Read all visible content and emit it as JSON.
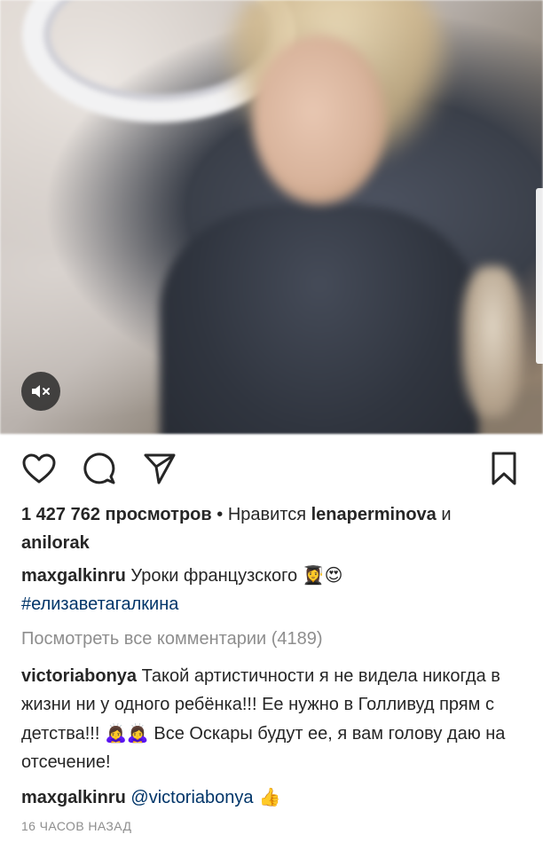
{
  "video": {
    "mute_icon": "speaker-muted-icon"
  },
  "actions": {
    "like_icon": "heart-icon",
    "comment_icon": "comment-bubble-icon",
    "share_icon": "paper-plane-icon",
    "save_icon": "bookmark-icon"
  },
  "stats": {
    "views": "1 427 762 просмотров",
    "separator": " • ",
    "liked_by_prefix": "Нравится ",
    "liked_user_1": "lenaperminova",
    "and": " и",
    "liked_user_2": "anilorak"
  },
  "caption": {
    "username": "maxgalkinru",
    "text": " Уроки французского ",
    "emoji_1": "👩‍🎓",
    "emoji_2": "😍",
    "hashtag": "#елизаветагалкина"
  },
  "view_all_comments": "Посмотреть все комментарии (4189)",
  "comments": [
    {
      "username": "victoriabonya",
      "text_1": " Такой артистичности я не видела никогда в жизни ни у одного ребёнка!!! Ее нужно в Голливуд прям с детства!!! ",
      "emoji": "🙇‍♀️🙇‍♀️",
      "text_2": " Все Оскары будут ее, я вам голову даю на отсечение!"
    },
    {
      "username": "maxgalkinru",
      "mention": " @victoriabonya",
      "emoji": " 👍"
    }
  ],
  "timestamp": "16 ЧАСОВ НАЗАД"
}
